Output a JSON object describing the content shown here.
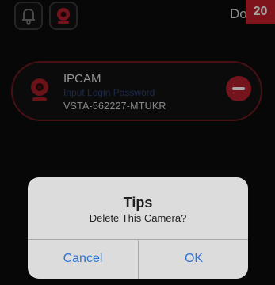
{
  "topbar": {
    "tabs": [
      {
        "icon": "bell-icon"
      },
      {
        "icon": "camera-icon",
        "active": true
      }
    ],
    "done_label": "Done",
    "done_visible_text": "Do",
    "badge_number": "20"
  },
  "camera": {
    "title": "IPCAM",
    "subtitle": "Input Login Password",
    "device_id": "VSTA-562227-MTUKR",
    "icon": "camera-icon",
    "remove_icon": "minus-circle-icon"
  },
  "dialog": {
    "title": "Tips",
    "message": "Delete This Camera?",
    "cancel_label": "Cancel",
    "ok_label": "OK"
  },
  "colors": {
    "accent_red": "#c41f2b",
    "dialog_button_blue": "#2f73d6",
    "background": "#0c0c0c"
  }
}
